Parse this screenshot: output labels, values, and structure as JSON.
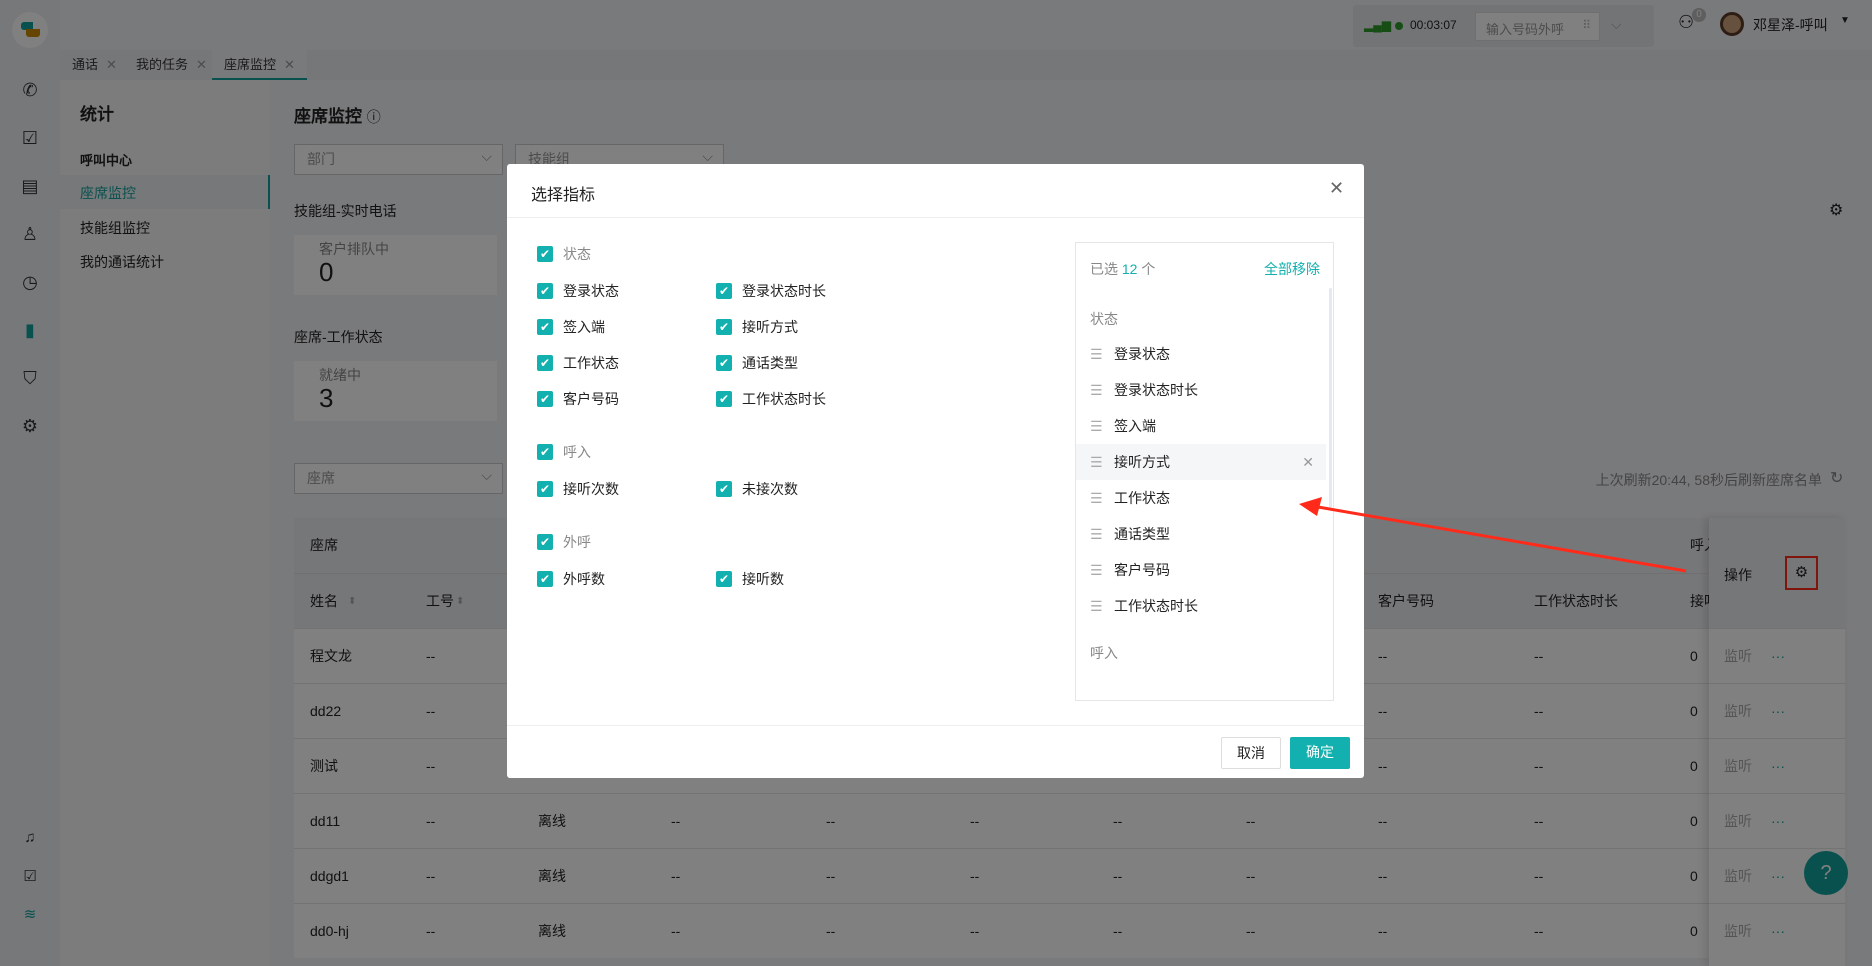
{
  "app": {
    "logo": "app-logo",
    "accent": "#12a29d"
  },
  "rail": {
    "icons": [
      "phone-icon",
      "task-icon",
      "document-icon",
      "contact-icon",
      "clock-icon",
      "chart-icon",
      "shield-search-icon",
      "settings-icon"
    ],
    "bottom_icons": [
      "bell-icon",
      "file-check-icon",
      "wifi-icon"
    ]
  },
  "topbar": {
    "call_timer": "00:03:07",
    "dial_placeholder": "输入号码外呼",
    "notification_count": "0",
    "user_name": "邓星泽-呼叫"
  },
  "tabs": [
    {
      "label": "通话"
    },
    {
      "label": "我的任务"
    },
    {
      "label": "座席监控",
      "active": true
    }
  ],
  "sidebar": {
    "title": "统计",
    "section": "呼叫中心",
    "items": [
      {
        "label": "座席监控",
        "active": true
      },
      {
        "label": "技能组监控"
      },
      {
        "label": "我的通话统计"
      }
    ]
  },
  "page": {
    "title": "座席监控",
    "filters": {
      "department": "部门",
      "skill_group": "技能组",
      "agent": "座席"
    },
    "realtime": {
      "title": "技能组-实时电话",
      "cards": [
        {
          "label": "客户排队中",
          "value": "0"
        }
      ]
    },
    "work": {
      "title": "座席-工作状态",
      "cards": [
        {
          "label": "就绪中",
          "value": "3"
        }
      ]
    },
    "refresh_text": "上次刷新20:44, 58秒后刷新座席名单"
  },
  "table": {
    "group_headers": [
      "座席",
      "呼入"
    ],
    "headers": [
      "姓名",
      "工号",
      "",
      "",
      "",
      "",
      "",
      "",
      "客户号码",
      "工作状态时长",
      "接听次数"
    ],
    "action_header": "操作",
    "rows": [
      {
        "cells": [
          "程文龙",
          "--",
          "",
          "",
          "",
          "",
          "",
          "",
          "--",
          "--",
          "0"
        ],
        "action": "监听"
      },
      {
        "cells": [
          "dd22",
          "--",
          "",
          "",
          "",
          "",
          "",
          "",
          "--",
          "--",
          "0"
        ],
        "action": "监听"
      },
      {
        "cells": [
          "测试",
          "--",
          "",
          "",
          "",
          "",
          "",
          "",
          "--",
          "--",
          "0"
        ],
        "action": "监听"
      },
      {
        "cells": [
          "dd11",
          "--",
          "离线",
          "--",
          "--",
          "--",
          "--",
          "--",
          "--",
          "--",
          "0"
        ],
        "action": "监听"
      },
      {
        "cells": [
          "ddgd1",
          "--",
          "离线",
          "--",
          "--",
          "--",
          "--",
          "--",
          "--",
          "--",
          "0"
        ],
        "action": "监听"
      },
      {
        "cells": [
          "dd0-hj",
          "--",
          "离线",
          "--",
          "--",
          "--",
          "--",
          "--",
          "--",
          "--",
          "0"
        ],
        "action": "监听"
      }
    ]
  },
  "dialog": {
    "title": "选择指标",
    "groups": [
      {
        "label": "状态",
        "items": [
          "登录状态",
          "登录状态时长",
          "签入端",
          "接听方式",
          "工作状态",
          "通话类型",
          "客户号码",
          "工作状态时长"
        ]
      },
      {
        "label": "呼入",
        "items": [
          "接听次数",
          "未接次数"
        ]
      },
      {
        "label": "外呼",
        "items": [
          "外呼数",
          "接听数"
        ]
      }
    ],
    "selected_prefix": "已选",
    "selected_count": "12",
    "selected_suffix": "个",
    "remove_all": "全部移除",
    "selected_groups": [
      "状态",
      "呼入"
    ],
    "selected_items": [
      "登录状态",
      "登录状态时长",
      "签入端",
      "接听方式",
      "工作状态",
      "通话类型",
      "客户号码",
      "工作状态时长"
    ],
    "cancel": "取消",
    "confirm": "确定"
  },
  "annotation": {
    "color": "#ff2a1a"
  }
}
